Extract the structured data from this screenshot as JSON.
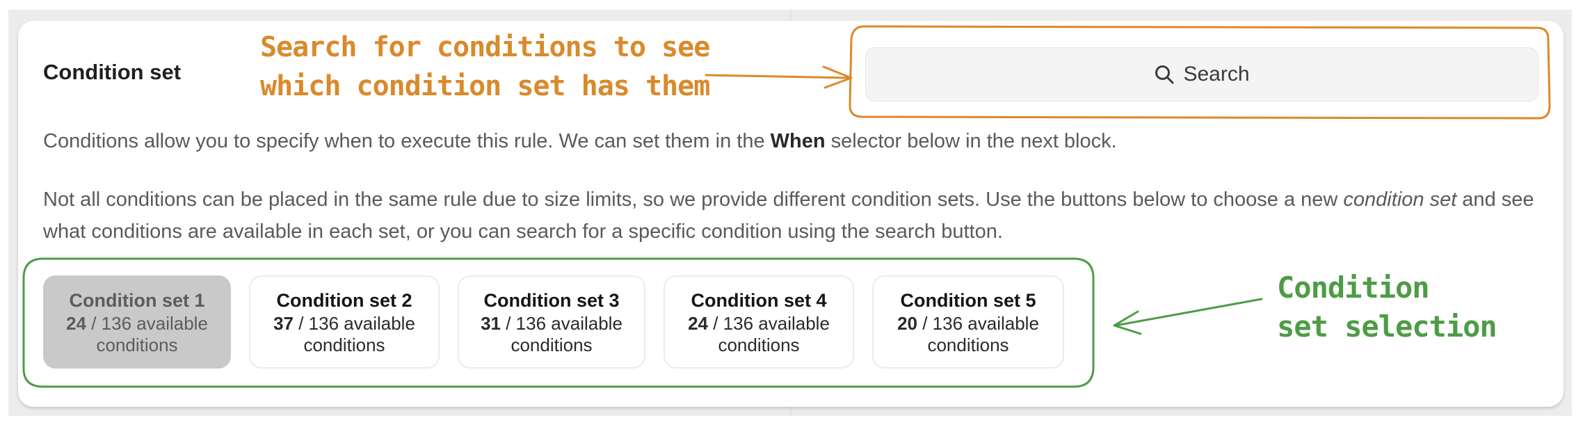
{
  "section": {
    "title": "Condition set",
    "search_label": "Search",
    "intro": {
      "before": "Conditions allow you to specify when to execute this rule. We can set them in the ",
      "bold": "When",
      "after": " selector below in the next block."
    },
    "explain": {
      "before": "Not all conditions can be placed in the same rule due to size limits, so we provide different condition sets. Use the buttons below to choose a new ",
      "italic": "condition set",
      "after": " and see what conditions are available in each set, or you can search for a specific condition using the search button."
    }
  },
  "condition_sets": [
    {
      "name": "Condition set 1",
      "available": "24",
      "rest": " / 136 available",
      "line2": "conditions",
      "selected": true
    },
    {
      "name": "Condition set 2",
      "available": "37",
      "rest": " / 136 available",
      "line2": "conditions",
      "selected": false
    },
    {
      "name": "Condition set 3",
      "available": "31",
      "rest": " / 136 available",
      "line2": "conditions",
      "selected": false
    },
    {
      "name": "Condition set 4",
      "available": "24",
      "rest": " / 136 available",
      "line2": "conditions",
      "selected": false
    },
    {
      "name": "Condition set 5",
      "available": "20",
      "rest": " / 136 available",
      "line2": "conditions",
      "selected": false
    }
  ],
  "annotations": {
    "search_line1": "Search for conditions to see",
    "search_line2": "which condition set has them",
    "sets_line1": "Condition",
    "sets_line2": "set selection",
    "orange": "#d98a2b",
    "green": "#4d9c45"
  },
  "icons": {
    "search": "search-icon"
  }
}
